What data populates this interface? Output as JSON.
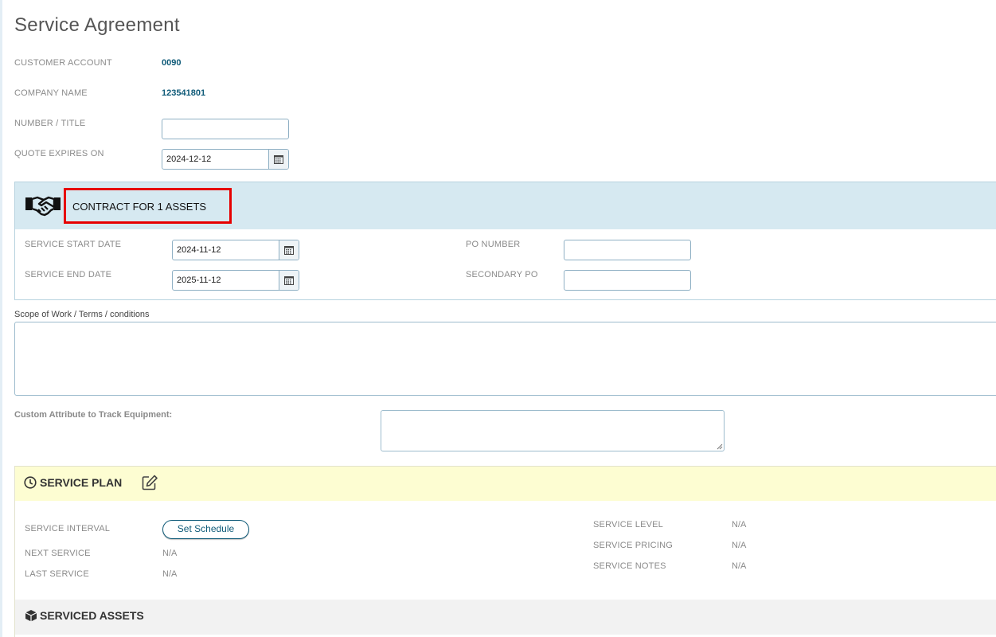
{
  "page": {
    "title": "Service Agreement"
  },
  "header_fields": {
    "customer_account_label": "CUSTOMER ACCOUNT",
    "customer_account_value": "0090",
    "company_name_label": "COMPANY NAME",
    "company_name_value": "123541801",
    "number_title_label": "NUMBER / TITLE",
    "number_title_value": "",
    "quote_expires_label": "QUOTE EXPIRES ON",
    "quote_expires_value": "2024-12-12"
  },
  "contract": {
    "title": "CONTRACT FOR 1 ASSETS",
    "icon": "handshake-icon",
    "service_start_label": "SERVICE START DATE",
    "service_start_value": "2024-11-12",
    "service_end_label": "SERVICE END DATE",
    "service_end_value": "2025-11-12",
    "po_number_label": "PO NUMBER",
    "po_number_value": "",
    "secondary_po_label": "SECONDARY PO",
    "secondary_po_value": ""
  },
  "scope": {
    "label": "Scope of Work / Terms / conditions",
    "value": ""
  },
  "custom_attribute": {
    "label": "Custom Attribute to Track Equipment:",
    "value": ""
  },
  "service_plan": {
    "title": "SERVICE PLAN",
    "clock_icon": "clock-icon",
    "edit_icon": "edit-icon",
    "interval_label": "SERVICE INTERVAL",
    "set_schedule_label": "Set Schedule",
    "next_service_label": "NEXT SERVICE",
    "next_service_value": "N/A",
    "last_service_label": "LAST SERVICE",
    "last_service_value": "N/A",
    "level_label": "SERVICE LEVEL",
    "level_value": "N/A",
    "pricing_label": "SERVICE PRICING",
    "pricing_value": "N/A",
    "notes_label": "SERVICE NOTES",
    "notes_value": "N/A"
  },
  "serviced_assets": {
    "title": "SERVICED ASSETS",
    "icon": "box-icon"
  },
  "colors": {
    "link": "#0e5a78",
    "contract_header_bg": "#d6e9f1",
    "plan_header_bg": "#fdfdd2",
    "highlight_border": "#e60000"
  }
}
